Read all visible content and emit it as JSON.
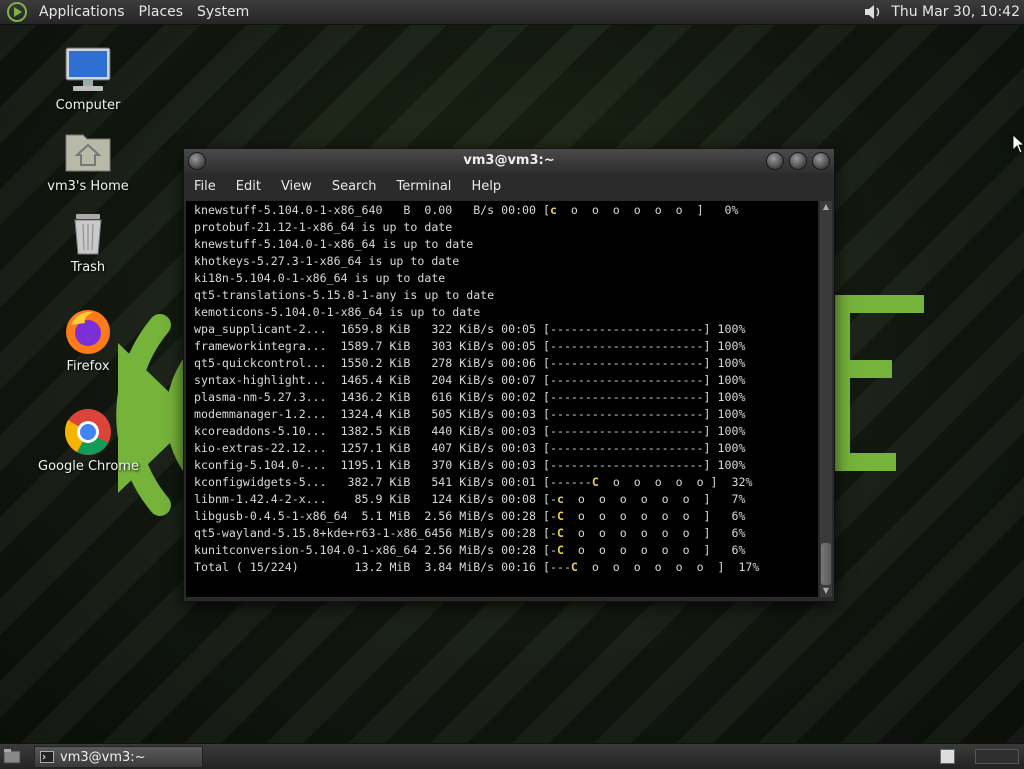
{
  "top_panel": {
    "menus": [
      "Applications",
      "Places",
      "System"
    ],
    "clock": "Thu Mar 30, 10:42",
    "icons": {
      "logo": "distro-logo-icon",
      "volume": "volume-icon"
    }
  },
  "desktop": {
    "icons": [
      {
        "label": "Computer",
        "icon": "computer-icon"
      },
      {
        "label": "vm3's Home",
        "icon": "home-folder-icon"
      },
      {
        "label": "Trash",
        "icon": "trash-icon"
      },
      {
        "label": "Firefox",
        "icon": "firefox-icon"
      },
      {
        "label": "Google Chrome",
        "icon": "chrome-icon"
      }
    ]
  },
  "terminal": {
    "title": "vm3@vm3:~",
    "menu": [
      "File",
      "Edit",
      "View",
      "Search",
      "Terminal",
      "Help"
    ],
    "lines": [
      "knewstuff-5.104.0-1-x86_640   B  0.00   B/s 00:00 [c  o  o  o  o  o  o  ]   0%",
      "protobuf-21.12-1-x86_64 is up to date",
      "knewstuff-5.104.0-1-x86_64 is up to date",
      "khotkeys-5.27.3-1-x86_64 is up to date",
      "ki18n-5.104.0-1-x86_64 is up to date",
      "qt5-translations-5.15.8-1-any is up to date",
      "kemoticons-5.104.0-1-x86_64 is up to date",
      "wpa_supplicant-2...  1659.8 KiB   322 KiB/s 00:05 [----------------------] 100%",
      "frameworkintegra...  1589.7 KiB   303 KiB/s 00:05 [----------------------] 100%",
      "qt5-quickcontrol...  1550.2 KiB   278 KiB/s 00:06 [----------------------] 100%",
      "syntax-highlight...  1465.4 KiB   204 KiB/s 00:07 [----------------------] 100%",
      "plasma-nm-5.27.3...  1436.2 KiB   616 KiB/s 00:02 [----------------------] 100%",
      "modemmanager-1.2...  1324.4 KiB   505 KiB/s 00:03 [----------------------] 100%",
      "kcoreaddons-5.10...  1382.5 KiB   440 KiB/s 00:03 [----------------------] 100%",
      "kio-extras-22.12...  1257.1 KiB   407 KiB/s 00:03 [----------------------] 100%",
      "kconfig-5.104.0-...  1195.1 KiB   370 KiB/s 00:03 [----------------------] 100%",
      "kconfigwidgets-5...   382.7 KiB   541 KiB/s 00:01 [------C  o  o  o  o  o ]  32%",
      "libnm-1.42.4-2-x...    85.9 KiB   124 KiB/s 00:08 [-c  o  o  o  o  o  o  ]   7%",
      "libgusb-0.4.5-1-x86_64  5.1 MiB  2.56 MiB/s 00:28 [-C  o  o  o  o  o  o  ]   6%",
      "qt5-wayland-5.15.8+kde+r63-1-x86_6456 MiB/s 00:28 [-C  o  o  o  o  o  o  ]   6%",
      "kunitconversion-5.104.0-1-x86_64 2.56 MiB/s 00:28 [-C  o  o  o  o  o  o  ]   6%",
      "Total ( 15/224)        13.2 MiB  3.84 MiB/s 00:16 [---C  o  o  o  o  o  o  ]  17%"
    ]
  },
  "taskbar": {
    "window_button": "vm3@vm3:~",
    "icons": {
      "show_desktop": "show-desktop-icon",
      "terminal": "terminal-icon"
    }
  },
  "colors": {
    "accent_green": "#7cb342",
    "pacman_yellow": "#e6d24a"
  }
}
